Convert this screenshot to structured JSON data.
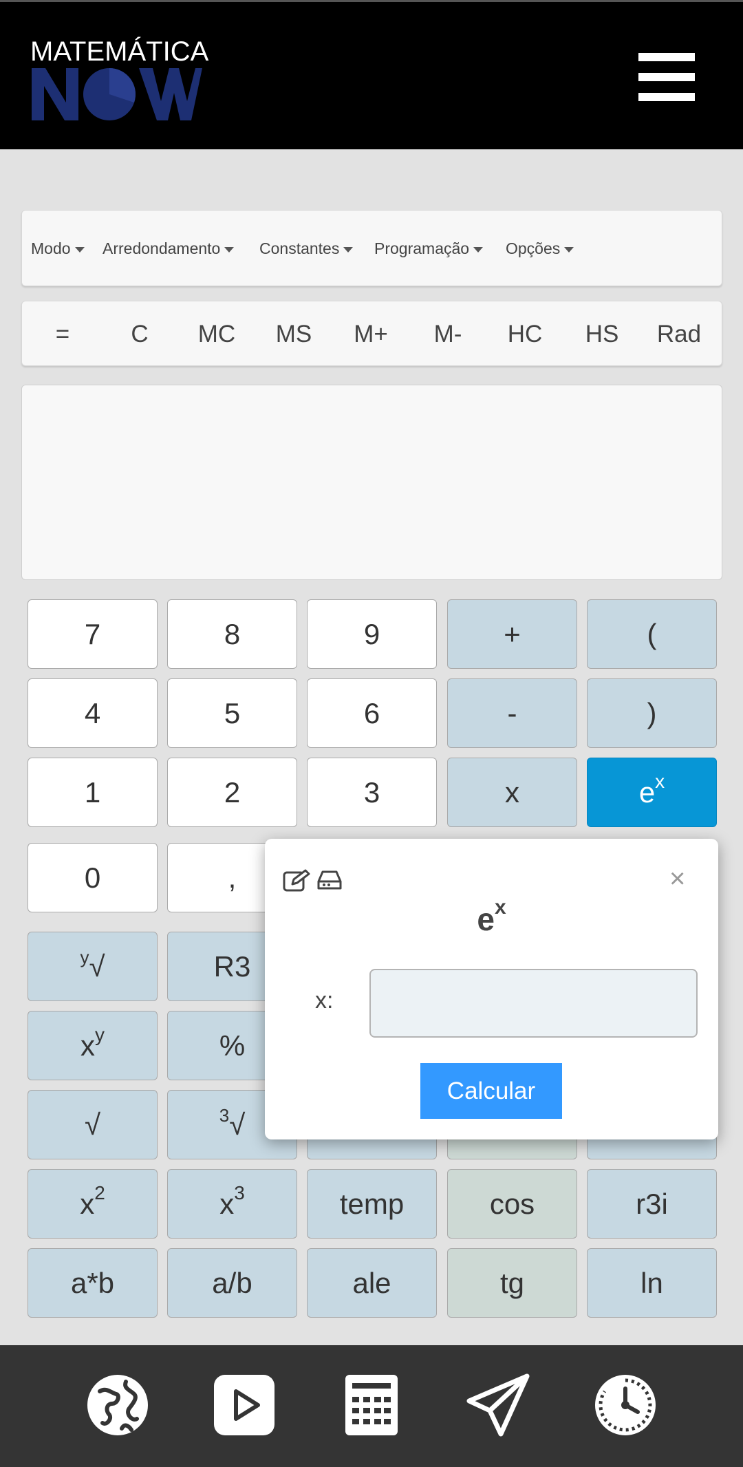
{
  "header": {
    "logo_top": "MATEMÁTICA",
    "logo_bottom": "NOW"
  },
  "menubar": {
    "items": [
      {
        "label": "Modo"
      },
      {
        "label": "Arredondamento"
      },
      {
        "label": "Constantes"
      },
      {
        "label": "Programação"
      },
      {
        "label": "Opções"
      }
    ]
  },
  "memory_bar": {
    "buttons": [
      "=",
      "C",
      "MC",
      "MS",
      "M+",
      "M-",
      "HC",
      "HS",
      "Rad"
    ]
  },
  "display": {
    "value": ""
  },
  "keypad": {
    "row1": [
      "7",
      "8",
      "9",
      "+",
      "("
    ],
    "row2": [
      "4",
      "5",
      "6",
      "-",
      ")"
    ],
    "row3": [
      "1",
      "2",
      "3",
      "x",
      "e"
    ],
    "row3_sup": "x",
    "row4": [
      "0",
      ","
    ],
    "root_y": "√",
    "root_y_pre": "y",
    "r3": "R3",
    "xy_base": "x",
    "xy_sup": "y",
    "percent": "%",
    "sqrt": "√",
    "cbrt": "√",
    "cbrt_pre": "3",
    "sq_base": "x",
    "sq_sup": "2",
    "cube_base": "x",
    "cube_sup": "3",
    "temp": "temp",
    "cos": "cos",
    "r3i": "r3i",
    "ab": "a*b",
    "adivb": "a/b",
    "ale": "ale",
    "tg": "tg",
    "ln": "ln"
  },
  "popup": {
    "title_base": "e",
    "title_sup": "x",
    "close": "×",
    "field_label": "x:",
    "field_value": "",
    "button_label": "Calcular"
  },
  "colors": {
    "header_bg": "#000000",
    "accent": "#0796d6",
    "op_key": "#c6d8e2",
    "trig_key": "#cdd9d4",
    "calc_button": "#3399ff",
    "bottom_nav": "#343434"
  },
  "bottom_nav": {
    "icons": [
      "globe-icon",
      "play-icon",
      "calculator-icon",
      "paper-plane-icon",
      "timer-icon"
    ]
  }
}
